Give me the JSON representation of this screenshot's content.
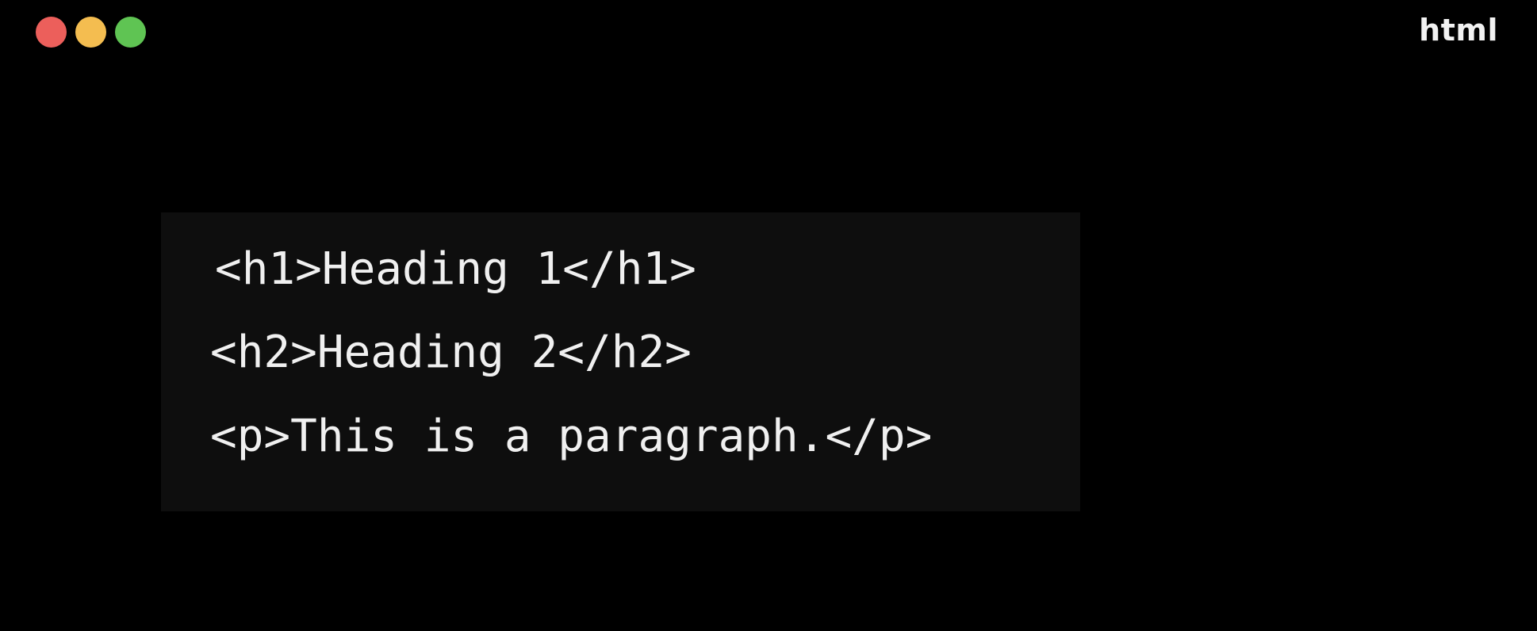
{
  "window": {
    "controls": [
      {
        "name": "close",
        "color": "#ec5f5b"
      },
      {
        "name": "minimize",
        "color": "#f4bd50"
      },
      {
        "name": "zoom",
        "color": "#5fc453"
      }
    ],
    "language_label": "html"
  },
  "code": {
    "background": "#0e0e0e",
    "lines": [
      "<h1>Heading 1</h1>",
      "<h2>Heading 2</h2>",
      "<p>This is a paragraph.</p>"
    ]
  }
}
